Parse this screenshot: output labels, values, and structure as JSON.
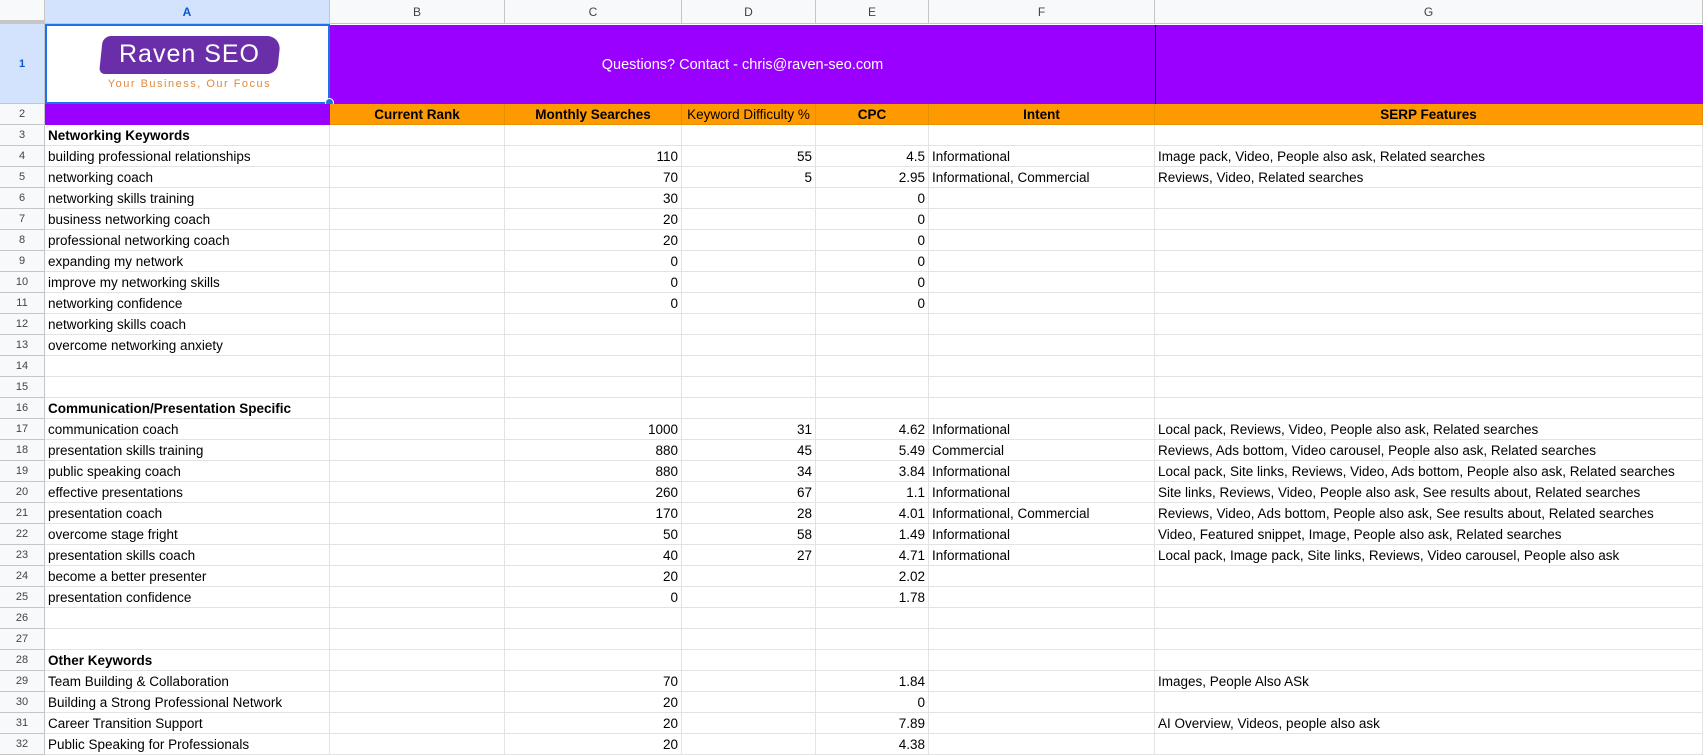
{
  "columns": [
    "A",
    "B",
    "C",
    "D",
    "E",
    "F",
    "G"
  ],
  "selected_cell": "A1",
  "logo": {
    "name": "Raven SEO",
    "tagline": "Your Business, Our Focus"
  },
  "banner": {
    "text": "Questions? Contact - chris@raven-seo.com"
  },
  "colors": {
    "banner": "#9900ff",
    "header_row": "#ff9900",
    "selection": "#1a73e8"
  },
  "headers": {
    "b": "Current Rank",
    "c": "Monthly Searches",
    "d": "Keyword Difficulty %",
    "e": "CPC",
    "f": "Intent",
    "g": "SERP Features"
  },
  "rows": [
    {
      "n": "3",
      "a": "Networking Keywords",
      "bold": true
    },
    {
      "n": "4",
      "a": "building professional relationships",
      "c": "110",
      "d": "55",
      "e": "4.5",
      "f": "Informational",
      "g": "Image pack, Video, People also ask, Related searches"
    },
    {
      "n": "5",
      "a": "networking coach",
      "c": "70",
      "d": "5",
      "e": "2.95",
      "f": "Informational, Commercial",
      "g": "Reviews, Video, Related searches"
    },
    {
      "n": "6",
      "a": "networking skills training",
      "c": "30",
      "e": "0"
    },
    {
      "n": "7",
      "a": "business networking coach",
      "c": "20",
      "e": "0"
    },
    {
      "n": "8",
      "a": "professional networking coach",
      "c": "20",
      "e": "0"
    },
    {
      "n": "9",
      "a": "expanding my network",
      "c": "0",
      "e": "0"
    },
    {
      "n": "10",
      "a": "improve my networking skills",
      "c": "0",
      "e": "0"
    },
    {
      "n": "11",
      "a": "networking confidence",
      "c": "0",
      "e": "0"
    },
    {
      "n": "12",
      "a": "networking skills coach"
    },
    {
      "n": "13",
      "a": "overcome networking anxiety"
    },
    {
      "n": "14"
    },
    {
      "n": "15"
    },
    {
      "n": "16",
      "a": "Communication/Presentation Specific",
      "bold": true
    },
    {
      "n": "17",
      "a": "communication coach",
      "c": "1000",
      "d": "31",
      "e": "4.62",
      "f": "Informational",
      "g": "Local pack, Reviews, Video, People also ask, Related searches"
    },
    {
      "n": "18",
      "a": "presentation skills training",
      "c": "880",
      "d": "45",
      "e": "5.49",
      "f": "Commercial",
      "g": "Reviews, Ads bottom, Video carousel, People also ask, Related searches"
    },
    {
      "n": "19",
      "a": "public speaking coach",
      "c": "880",
      "d": "34",
      "e": "3.84",
      "f": "Informational",
      "g": "Local pack, Site links, Reviews, Video, Ads bottom, People also ask, Related searches"
    },
    {
      "n": "20",
      "a": "effective presentations",
      "c": "260",
      "d": "67",
      "e": "1.1",
      "f": "Informational",
      "g": "Site links, Reviews, Video, People also ask, See results about, Related searches"
    },
    {
      "n": "21",
      "a": "presentation coach",
      "c": "170",
      "d": "28",
      "e": "4.01",
      "f": "Informational, Commercial",
      "g": "Reviews, Video, Ads bottom, People also ask, See results about, Related searches"
    },
    {
      "n": "22",
      "a": "overcome stage fright",
      "c": "50",
      "d": "58",
      "e": "1.49",
      "f": "Informational",
      "g": "Video, Featured snippet, Image, People also ask, Related searches"
    },
    {
      "n": "23",
      "a": "presentation skills coach",
      "c": "40",
      "d": "27",
      "e": "4.71",
      "f": "Informational",
      "g": "Local pack, Image pack, Site links, Reviews, Video carousel, People also ask"
    },
    {
      "n": "24",
      "a": "become a better presenter",
      "c": "20",
      "e": "2.02"
    },
    {
      "n": "25",
      "a": "presentation confidence",
      "c": "0",
      "e": "1.78"
    },
    {
      "n": "26"
    },
    {
      "n": "27"
    },
    {
      "n": "28",
      "a": "Other Keywords",
      "bold": true
    },
    {
      "n": "29",
      "a": "Team Building & Collaboration",
      "c": "70",
      "e": "1.84",
      "g": "Images, People Also ASk"
    },
    {
      "n": "30",
      "a": "Building a Strong Professional Network",
      "c": "20",
      "e": "0"
    },
    {
      "n": "31",
      "a": "Career Transition Support",
      "c": "20",
      "e": "7.89",
      "g": "AI Overview, Videos, people also ask"
    },
    {
      "n": "32",
      "a": "Public Speaking for Professionals",
      "c": "20",
      "e": "4.38"
    }
  ]
}
